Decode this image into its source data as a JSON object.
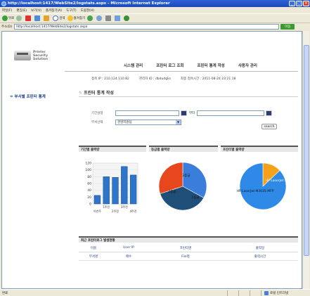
{
  "window": {
    "title": "http://localhost:1417/WebSite2/logstats.aspx - Microsoft Internet Explorer",
    "minimize": "_",
    "maximize": "□",
    "close": "✕"
  },
  "menu": [
    "파일(F)",
    "편집(E)",
    "보기(V)",
    "즐겨찾기(A)",
    "도구(T)",
    "도움말(H)"
  ],
  "toolbar": {
    "back": "뒤로",
    "search": "검색",
    "favorites": "즐겨찾기"
  },
  "address": {
    "label": "주소(D)",
    "url": "http://localhost:1417/WebSite2/logstats.aspx",
    "go": "이동"
  },
  "logo": {
    "line1": "Printer",
    "line2": "Security",
    "line3": "Solution"
  },
  "topnav": [
    "시스템 관리",
    "프린터 로그 조회",
    "프린터 통계 작성",
    "사용자 관리"
  ],
  "info": {
    "ip": "접속 IP : 210.124.110.82",
    "admin": "관리자 ID : dbdudgks",
    "last_login": "최종 접속시간 : 2011-08-24 23:21:18"
  },
  "side_menu": {
    "item": "부서별 프린터 통계"
  },
  "page_title": "프린터 통계 작성",
  "form": {
    "period_label": "기간설정",
    "tilde": "부터",
    "dept_label": "부서선택",
    "dept_value": "경영지원팀",
    "search": "search"
  },
  "panels": {
    "period": "기간별 출력량",
    "grade": "등급별 출력량",
    "printer": "프린터별 출력량"
  },
  "bar_chart": {
    "y_ticks": [
      "120",
      "100",
      "80",
      "60",
      "40",
      "20",
      "0"
    ],
    "x_top": [
      "1주전",
      "3주전"
    ],
    "x_bottom": [
      "이번주",
      "2주전",
      "4주전"
    ]
  },
  "chart_data": [
    {
      "type": "bar",
      "categories": [
        "이번주",
        "1주전",
        "2주전",
        "3주전",
        "4주전"
      ],
      "values": [
        25,
        80,
        78,
        110,
        85
      ],
      "ylim": [
        0,
        120
      ]
    },
    {
      "type": "pie",
      "labels": [
        "3등급",
        "2등급",
        "1등급"
      ],
      "values": [
        33,
        37,
        30
      ],
      "colors": [
        "#3a7ddb",
        "#1f4e79",
        "#e8461c"
      ]
    },
    {
      "type": "pie",
      "labels": [
        "HP LaserJet 1200",
        "HP LaserJet M3035 MFP"
      ],
      "values": [
        13,
        87
      ],
      "colors": [
        "#f5a21a",
        "#2e8ae6"
      ]
    }
  ],
  "log": {
    "title": "최근 프린터로그 발생현황",
    "header1": [
      "이름",
      "User IP",
      "프린터명",
      "출력일"
    ],
    "header2": [
      "부서명",
      "매수",
      "File명",
      "출력시간"
    ]
  },
  "status": {
    "left": "완료",
    "zone": "로컬 인트라넷"
  }
}
